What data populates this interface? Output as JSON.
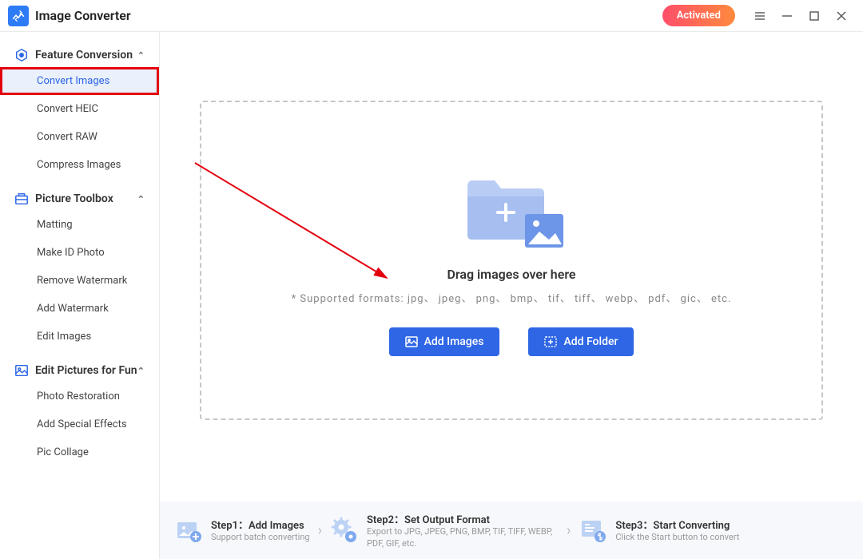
{
  "app": {
    "title": "Image Converter"
  },
  "titlebar": {
    "activated": "Activated"
  },
  "sidebar": {
    "sections": [
      {
        "title": "Feature Conversion",
        "items": [
          {
            "label": "Convert Images",
            "active": true,
            "highlighted": true
          },
          {
            "label": "Convert HEIC"
          },
          {
            "label": "Convert RAW"
          },
          {
            "label": "Compress Images"
          }
        ]
      },
      {
        "title": "Picture Toolbox",
        "items": [
          {
            "label": "Matting"
          },
          {
            "label": "Make ID Photo"
          },
          {
            "label": "Remove Watermark"
          },
          {
            "label": "Add Watermark"
          },
          {
            "label": "Edit Images"
          }
        ]
      },
      {
        "title": "Edit Pictures for Fun",
        "items": [
          {
            "label": "Photo Restoration"
          },
          {
            "label": "Add Special Effects"
          },
          {
            "label": "Pic Collage"
          }
        ]
      }
    ]
  },
  "dropzone": {
    "drag_text": "Drag images over here",
    "formats": "* Supported formats: jpg、 jpeg、 png、 bmp、 tif、 tiff、 webp、 pdf、 gic、 etc.",
    "add_images": "Add Images",
    "add_folder": "Add Folder"
  },
  "steps": [
    {
      "title": "Step1：Add Images",
      "desc": "Support batch converting"
    },
    {
      "title": "Step2：Set Output Format",
      "desc": "Export to JPG, JPEG, PNG, BMP, TIF, TIFF, WEBP, PDF, GIF, etc."
    },
    {
      "title": "Step3：Start Converting",
      "desc": "Click the Start button to convert"
    }
  ]
}
